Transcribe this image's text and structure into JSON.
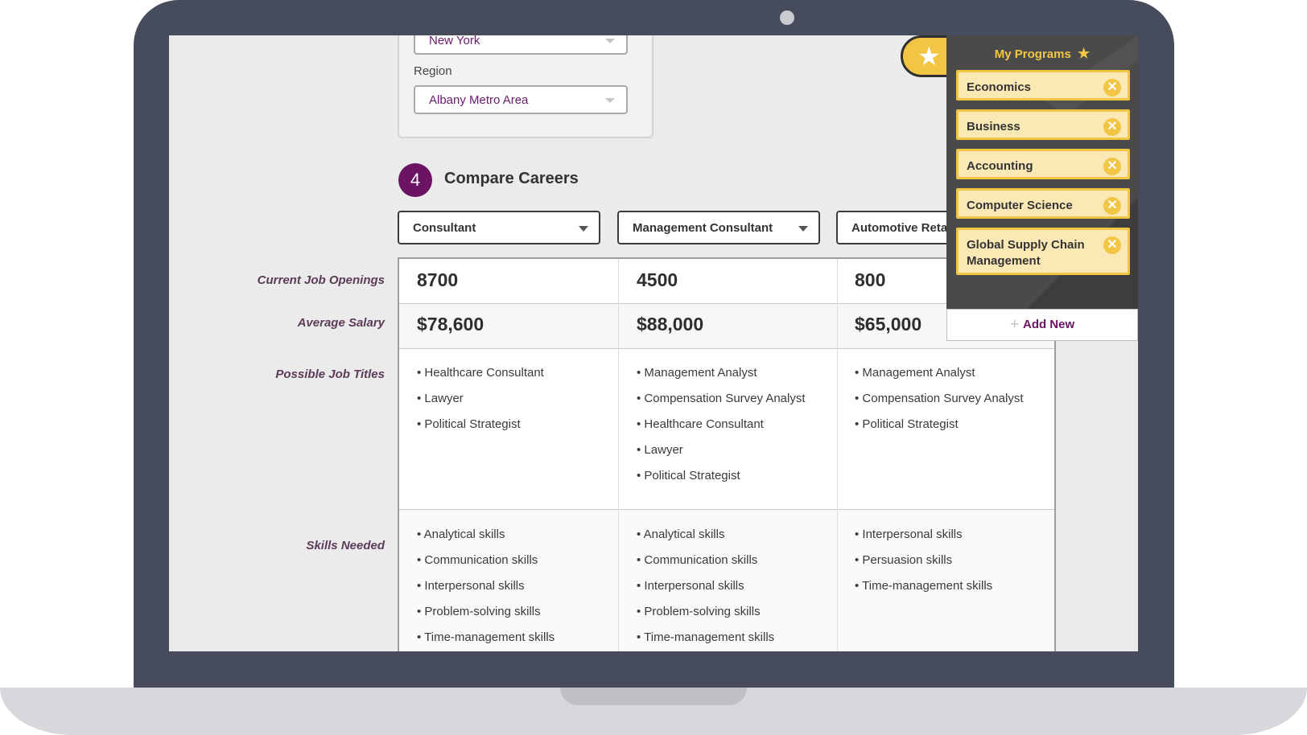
{
  "location": {
    "state_value": "New York",
    "region_label": "Region",
    "region_value": "Albany Metro Area"
  },
  "step": {
    "number": "4",
    "title": "Compare Careers"
  },
  "careers": [
    "Consultant",
    "Management Consultant",
    "Automotive Reta"
  ],
  "row_labels": {
    "openings": "Current Job Openings",
    "salary": "Average Salary",
    "titles": "Possible Job Titles",
    "skills": "Skills Needed"
  },
  "columns": [
    {
      "openings": "8700",
      "salary": "$78,600",
      "titles": [
        "Healthcare Consultant",
        "Lawyer",
        "Political Strategist"
      ],
      "skills": [
        "Analytical skills",
        "Communication skills",
        "Interpersonal skills",
        "Problem-solving skills",
        "Time-management skills"
      ]
    },
    {
      "openings": "4500",
      "salary": "$88,000",
      "titles": [
        "Management Analyst",
        "Compensation Survey Analyst",
        "Healthcare Consultant",
        "Lawyer",
        "Political Strategist"
      ],
      "skills": [
        "Analytical skills",
        "Communication skills",
        "Interpersonal skills",
        "Problem-solving skills",
        "Time-management skills"
      ]
    },
    {
      "openings": "800",
      "salary": "$65,000",
      "titles": [
        "Management Analyst",
        "Compensation Survey Analyst",
        "Political Strategist"
      ],
      "skills": [
        "Interpersonal skills",
        "Persuasion skills",
        "Time-management skills"
      ]
    }
  ],
  "my_programs": {
    "title": "My Programs",
    "title_icon": "star-icon",
    "items": [
      "Economics",
      "Business",
      "Accounting",
      "Computer Science",
      "Global Supply Chain Management"
    ],
    "remove_icon": "close-circle-icon",
    "add_new_label": "Add New",
    "add_icon": "plus-icon"
  },
  "colors": {
    "brand_purple": "#6b1463",
    "accent_yellow": "#f2c543",
    "program_bg": "#fbe9b5",
    "panel_bg": "#4a4a4a"
  }
}
